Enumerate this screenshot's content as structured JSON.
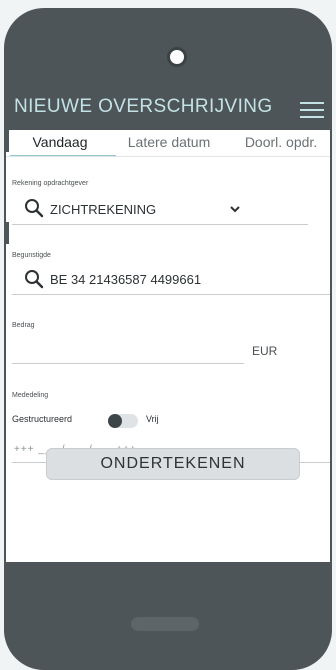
{
  "header": {
    "title": "NIEUWE OVERSCHRIJVING"
  },
  "tabs": [
    {
      "label": "Vandaag",
      "active": true
    },
    {
      "label": "Latere datum",
      "active": false
    },
    {
      "label": "Doorl. opdr.",
      "active": false
    }
  ],
  "account": {
    "label": "Rekening opdrachtgever",
    "value": "ZICHTREKENING",
    "icon": "chevron-down-icon"
  },
  "beneficiary": {
    "label": "Begunstigde",
    "value": "BE 34 21436587 4499661",
    "icon": "search-icon"
  },
  "amount": {
    "label": "Bedrag",
    "value": "",
    "currency": "EUR"
  },
  "message": {
    "label": "Mededeling",
    "structured_label": "Gestructureerd",
    "free_label": "Vrij",
    "structured_value": "+++ ___ /___ /___ +++"
  },
  "actions": {
    "sign_label": "ONDERTEKENEN"
  },
  "colors": {
    "phone": "#4d5559",
    "title_text": "#c3e2e6",
    "active_tab_underline": "#8fc7ce",
    "button_bg": "#dcdfe1"
  }
}
